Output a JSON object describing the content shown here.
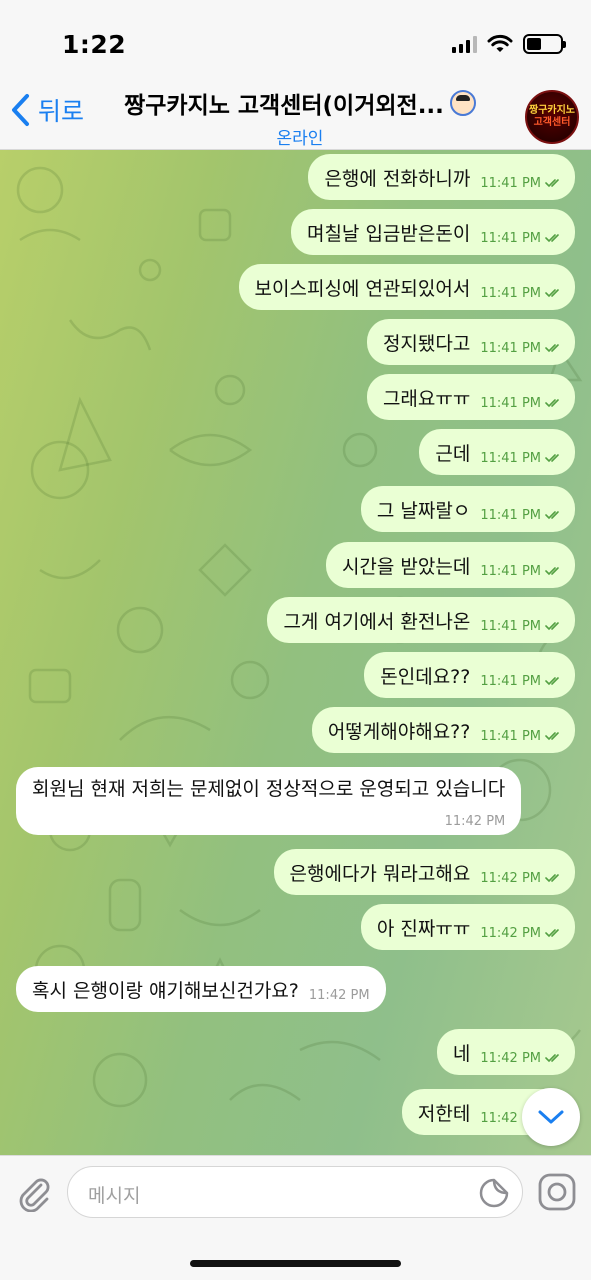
{
  "status_bar": {
    "time": "1:22",
    "battery_fraction": 0.45
  },
  "header": {
    "back_label": "뒤로",
    "title": "짱구카지노 고객센터(이거외전...",
    "status": "온라인",
    "avatar_text": [
      "짱구카지노",
      "고객센터"
    ]
  },
  "messages": [
    {
      "dir": "out",
      "text": "은행에 전화하니까",
      "time": "11:41 PM"
    },
    {
      "dir": "out",
      "text": "며칠날 입금받은돈이",
      "time": "11:41 PM"
    },
    {
      "dir": "out",
      "text": "보이스피싱에 연관되있어서",
      "time": "11:41 PM"
    },
    {
      "dir": "out",
      "text": "정지됐다고",
      "time": "11:41 PM"
    },
    {
      "dir": "out",
      "text": "그래요ㅠㅠ",
      "time": "11:41 PM"
    },
    {
      "dir": "out",
      "text": "근데",
      "time": "11:41 PM"
    },
    {
      "dir": "out",
      "text": "그 날짜랄ㅇ",
      "time": "11:41 PM"
    },
    {
      "dir": "out",
      "text": "시간을 받았는데",
      "time": "11:41 PM"
    },
    {
      "dir": "out",
      "text": "그게 여기에서 환전나온",
      "time": "11:41 PM"
    },
    {
      "dir": "out",
      "text": "돈인데요??",
      "time": "11:41 PM"
    },
    {
      "dir": "out",
      "text": "어떻게해야해요??",
      "time": "11:41 PM"
    },
    {
      "dir": "in",
      "text": "회원님 현재 저희는 문제없이 정상적으로 운영되고 있습니다",
      "time": "11:42 PM"
    },
    {
      "dir": "out",
      "text": "은행에다가 뭐라고해요",
      "time": "11:42 PM"
    },
    {
      "dir": "out",
      "text": "아 진짜ㅠㅠ",
      "time": "11:42 PM"
    },
    {
      "dir": "in",
      "text": "혹시 은행이랑 얘기해보신건가요?",
      "time": "11:42 PM"
    },
    {
      "dir": "out",
      "text": "네",
      "time": "11:42 PM"
    },
    {
      "dir": "out",
      "text": "저한테",
      "time": "11:42 PM"
    }
  ],
  "input": {
    "placeholder": "메시지"
  },
  "icons": {
    "back": "chevron-left-icon",
    "attach": "paperclip-icon",
    "sticker": "sticker-icon",
    "camera": "camera-icon",
    "scroll_down": "chevron-down-icon",
    "read": "double-check-icon"
  },
  "colors": {
    "accent": "#1a7ff0",
    "outgoing_bubble": "#eaffd4",
    "incoming_bubble": "#ffffff",
    "outgoing_time": "#54a043"
  }
}
